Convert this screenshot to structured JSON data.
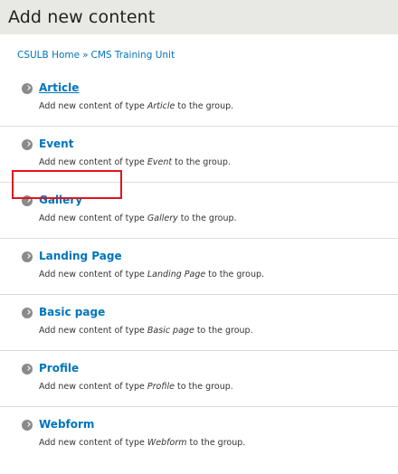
{
  "header": {
    "title": "Add new content"
  },
  "breadcrumb": {
    "home": "CSULB Home",
    "separator": "»",
    "unit": "CMS Training Unit"
  },
  "desc_template": {
    "prefix": "Add new content of type",
    "suffix": "to the group."
  },
  "items": [
    {
      "label": "Article",
      "type": "Article"
    },
    {
      "label": "Event",
      "type": "Event"
    },
    {
      "label": "Gallery",
      "type": "Gallery"
    },
    {
      "label": "Landing Page",
      "type": "Landing Page"
    },
    {
      "label": "Basic page",
      "type": "Basic page"
    },
    {
      "label": "Profile",
      "type": "Profile"
    },
    {
      "label": "Webform",
      "type": "Webform"
    }
  ],
  "colors": {
    "link": "#0074bd",
    "header_bg": "#e8e8e4",
    "highlight": "#e0141e"
  }
}
